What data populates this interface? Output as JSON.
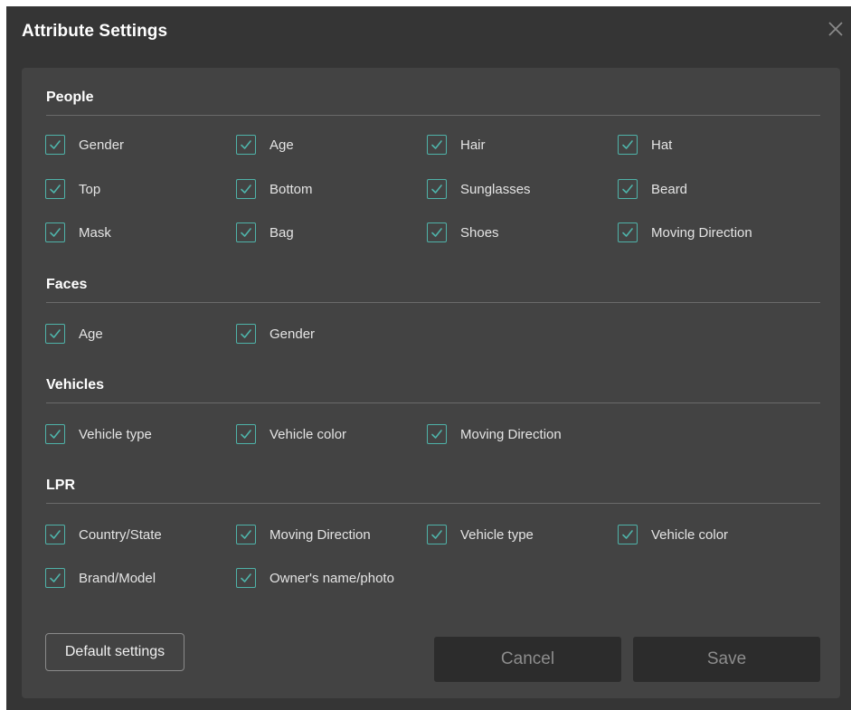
{
  "dialog": {
    "title": "Attribute Settings",
    "close_icon": "close-icon",
    "accent_color": "#4fb3a9",
    "background_color": "#353535",
    "panel_color": "#434343"
  },
  "sections": {
    "people": {
      "title": "People",
      "options": [
        {
          "label": "Gender",
          "checked": true
        },
        {
          "label": "Age",
          "checked": true
        },
        {
          "label": "Hair",
          "checked": true
        },
        {
          "label": "Hat",
          "checked": true
        },
        {
          "label": "Top",
          "checked": true
        },
        {
          "label": "Bottom",
          "checked": true
        },
        {
          "label": "Sunglasses",
          "checked": true
        },
        {
          "label": "Beard",
          "checked": true
        },
        {
          "label": "Mask",
          "checked": true
        },
        {
          "label": "Bag",
          "checked": true
        },
        {
          "label": "Shoes",
          "checked": true
        },
        {
          "label": "Moving Direction",
          "checked": true
        }
      ]
    },
    "faces": {
      "title": "Faces",
      "options": [
        {
          "label": "Age",
          "checked": true
        },
        {
          "label": "Gender",
          "checked": true
        }
      ]
    },
    "vehicles": {
      "title": "Vehicles",
      "options": [
        {
          "label": "Vehicle type",
          "checked": true
        },
        {
          "label": "Vehicle color",
          "checked": true
        },
        {
          "label": "Moving Direction",
          "checked": true
        }
      ]
    },
    "lpr": {
      "title": "LPR",
      "options": [
        {
          "label": "Country/State",
          "checked": true
        },
        {
          "label": "Moving Direction",
          "checked": true
        },
        {
          "label": "Vehicle type",
          "checked": true
        },
        {
          "label": "Vehicle color",
          "checked": true
        },
        {
          "label": "Brand/Model",
          "checked": true
        },
        {
          "label": "Owner's name/photo",
          "checked": true
        }
      ]
    }
  },
  "footer": {
    "default_label": "Default settings",
    "cancel_label": "Cancel",
    "save_label": "Save"
  }
}
